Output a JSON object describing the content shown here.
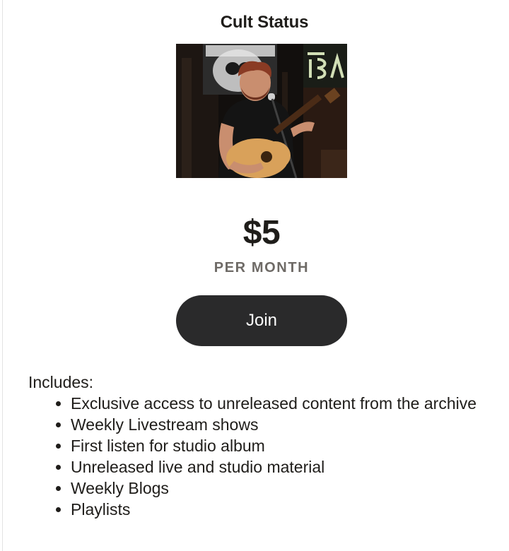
{
  "tier": {
    "title": "Cult Status",
    "image_alt": "Performer singing with acoustic guitar",
    "price": "$5",
    "period": "PER MONTH",
    "join_label": "Join"
  },
  "benefits": {
    "heading": "Includes:",
    "items": [
      "Exclusive access to unreleased content from the archive",
      "Weekly Livestream shows",
      "First listen for studio album",
      "Unreleased live and studio material",
      "Weekly Blogs",
      "Playlists"
    ]
  },
  "colors": {
    "button_bg": "#2a2a2b",
    "text": "#1f1d1a",
    "muted": "#6e6a66"
  }
}
